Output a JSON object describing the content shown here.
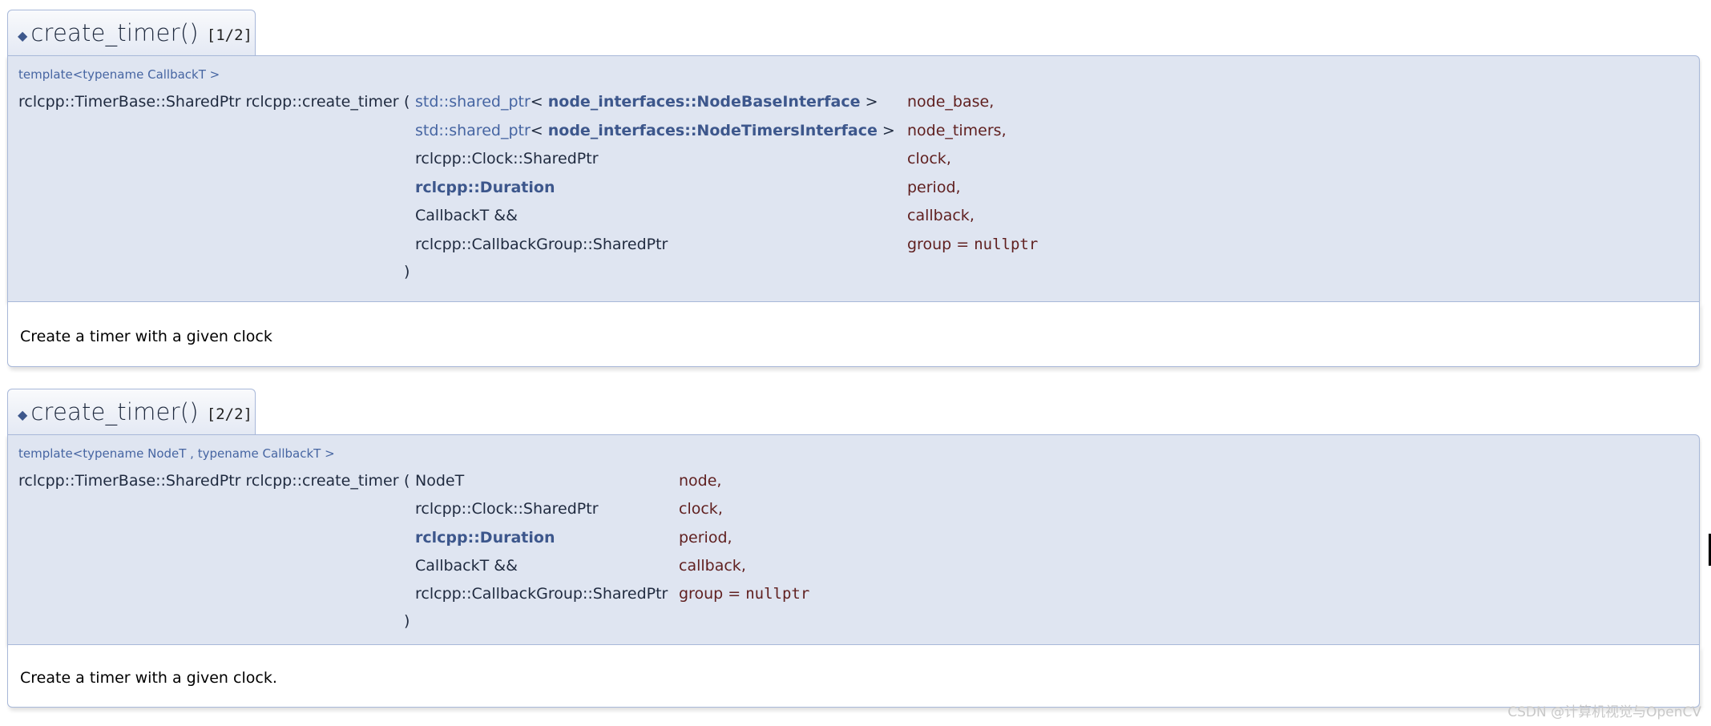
{
  "items": [
    {
      "func_name": "create_timer()",
      "overload": "[1/2]",
      "template": "template<typename CallbackT >",
      "return_type": "rclcpp::TimerBase::SharedPtr rclcpp::create_timer",
      "open_paren": "(",
      "close_paren": ")",
      "params": [
        {
          "type_prefix": "std::shared_ptr",
          "type_mid": "< ",
          "type_bold": "node_interfaces::NodeBaseInterface",
          "type_suffix": " >",
          "name": "node_base",
          "sep": ",",
          "default": ""
        },
        {
          "type_prefix": "std::shared_ptr",
          "type_mid": "< ",
          "type_bold": "node_interfaces::NodeTimersInterface",
          "type_suffix": " >",
          "name": "node_timers",
          "sep": ",",
          "default": ""
        },
        {
          "type_prefix": "",
          "type_mid": "rclcpp::Clock::SharedPtr",
          "type_bold": "",
          "type_suffix": "",
          "name": "clock",
          "sep": ",",
          "default": ""
        },
        {
          "type_prefix": "",
          "type_mid": "",
          "type_bold": "rclcpp::Duration",
          "type_suffix": "",
          "name": "period",
          "sep": ",",
          "default": ""
        },
        {
          "type_prefix": "",
          "type_mid": "CallbackT &&",
          "type_bold": "",
          "type_suffix": "",
          "name": "callback",
          "sep": ",",
          "default": ""
        },
        {
          "type_prefix": "",
          "type_mid": "rclcpp::CallbackGroup::SharedPtr",
          "type_bold": "",
          "type_suffix": "",
          "name": "group",
          "sep": " = ",
          "default": "nullptr"
        }
      ],
      "description": "Create a timer with a given clock"
    },
    {
      "func_name": "create_timer()",
      "overload": "[2/2]",
      "template": "template<typename NodeT , typename CallbackT >",
      "return_type": "rclcpp::TimerBase::SharedPtr rclcpp::create_timer",
      "open_paren": "(",
      "close_paren": ")",
      "params": [
        {
          "type_prefix": "",
          "type_mid": "NodeT",
          "type_bold": "",
          "type_suffix": "",
          "name": "node",
          "sep": ",",
          "default": ""
        },
        {
          "type_prefix": "",
          "type_mid": "rclcpp::Clock::SharedPtr",
          "type_bold": "",
          "type_suffix": "",
          "name": "clock",
          "sep": ",",
          "default": ""
        },
        {
          "type_prefix": "",
          "type_mid": "",
          "type_bold": "rclcpp::Duration",
          "type_suffix": "",
          "name": "period",
          "sep": ",",
          "default": ""
        },
        {
          "type_prefix": "",
          "type_mid": "CallbackT &&",
          "type_bold": "",
          "type_suffix": "",
          "name": "callback",
          "sep": ",",
          "default": ""
        },
        {
          "type_prefix": "",
          "type_mid": "rclcpp::CallbackGroup::SharedPtr",
          "type_bold": "",
          "type_suffix": "",
          "name": "group",
          "sep": " = ",
          "default": "nullptr"
        }
      ],
      "description": "Create a timer with a given clock."
    }
  ],
  "watermark": "CSDN @计算机视觉与OpenCV",
  "colors": {
    "proto_bg": "#dfe5f1",
    "border": "#a8b8d9",
    "link": "#4665a2",
    "bold_link": "#3d578c",
    "param_name": "#602020"
  }
}
